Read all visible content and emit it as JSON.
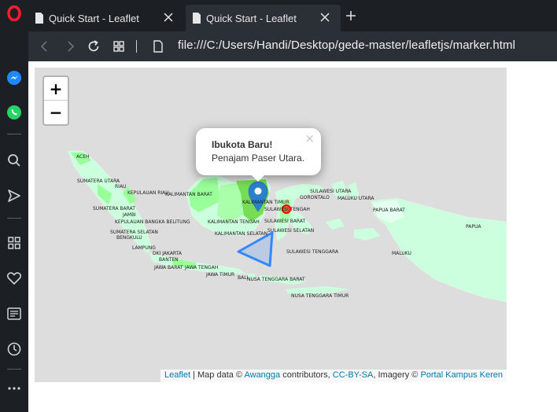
{
  "browser": {
    "tabs": [
      {
        "title": "Quick Start - Leaflet"
      },
      {
        "title": "Quick Start - Leaflet"
      }
    ],
    "url": "file:///C:/Users/Handi/Desktop/gede-master/leafletjs/marker.html"
  },
  "sidebar": {
    "icons": [
      "opera-logo-icon",
      "messenger-icon",
      "whatsapp-icon",
      "search-icon",
      "send-icon",
      "speed-dial-icon",
      "heart-icon",
      "news-icon",
      "history-icon",
      "more-icon"
    ]
  },
  "map": {
    "zoom_in": "+",
    "zoom_out": "−",
    "popup": {
      "title": "Ibukota Baru!",
      "text": "Penajam Paser Utara.",
      "close": "×"
    },
    "labels": [
      "ACEH",
      "SUMATERA UTARA",
      "RIAU",
      "KEPULAUAN RIAU",
      "KALIMANTAN BARAT",
      "SUMATERA BARAT",
      "JAMBI",
      "KEPULAUAN BANGKA BELITUNG",
      "KALIMANTAN TENGAH",
      "SUMATERA SELATAN",
      "BENGKULU",
      "KALIMANTAN SELATAN",
      "LAMPUNG",
      "DKI JAKARTA",
      "BANTEN",
      "JAWA BARAT",
      "JAWA TENGAH",
      "JAWA TIMUR",
      "BALI",
      "NUSA TENGGARA BARAT",
      "NUSA TENGGARA TIMUR",
      "KALIMANTAN TIMUR",
      "SULAWESI TENGAH",
      "SULAWESI BARAT",
      "SULAWESI SELATAN",
      "SULAWESI TENGGARA",
      "SULAWESI UTARA",
      "GORONTALO",
      "MALUKU UTARA",
      "PAPUA BARAT",
      "PAPUA",
      "MALUKU"
    ],
    "attribution": {
      "leaflet": "Leaflet",
      "sep1": " | Map data © ",
      "awangga": "Awangga",
      "mid": " contributors, ",
      "license": "CC-BY-SA",
      "imagery": ", Imagery © ",
      "portal": "Portal Kampus Keren"
    },
    "colors": {
      "land_light": "#ccffdd",
      "land_mid": "#99ff99",
      "land_green": "#77dd55",
      "marker": "#2a81cb",
      "circle": "#ff0000",
      "polygon": "#3388ff"
    }
  }
}
